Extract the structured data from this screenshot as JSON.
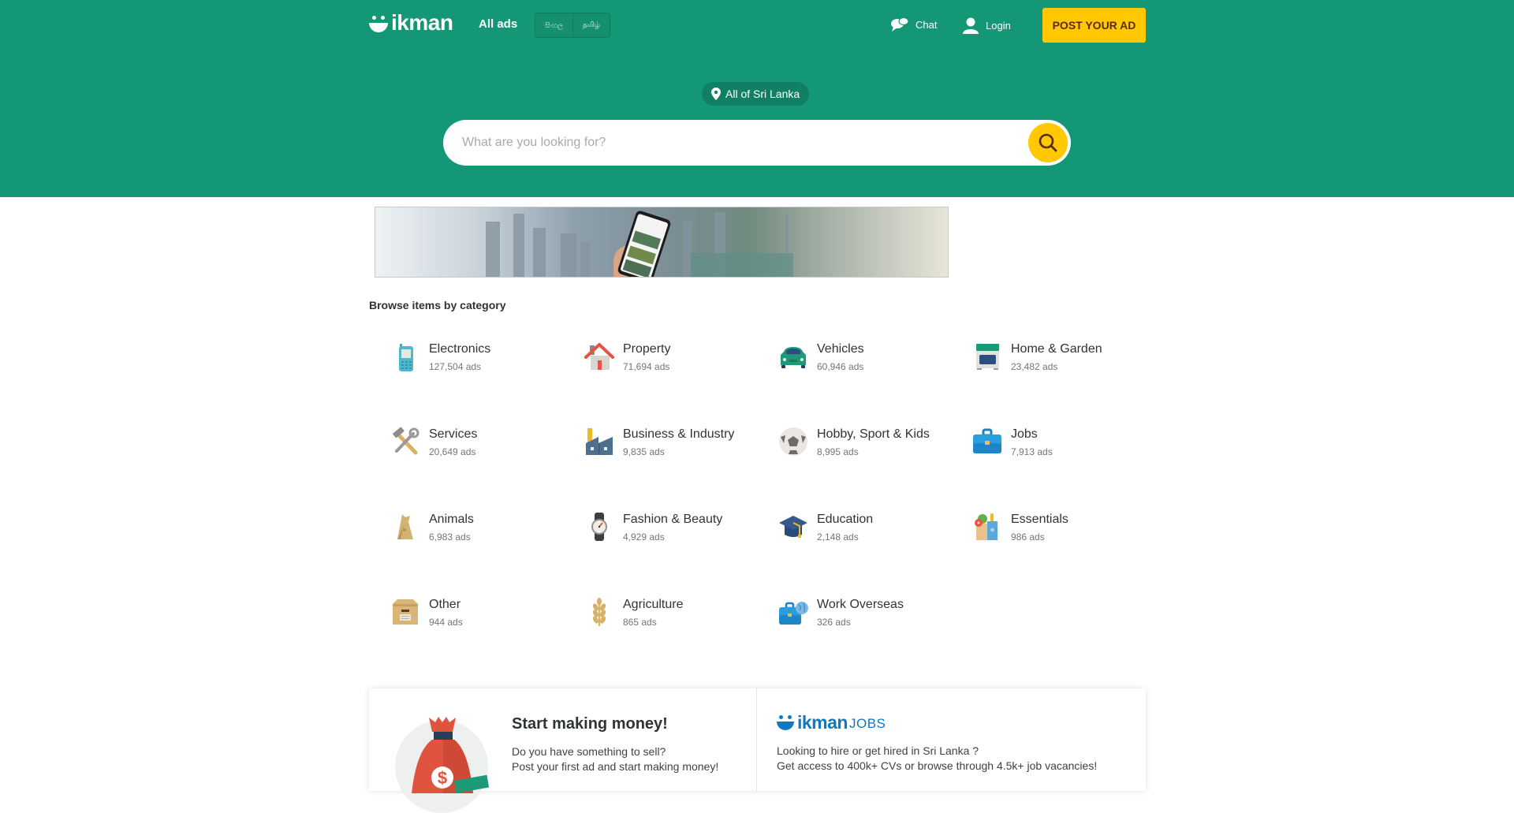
{
  "header": {
    "logo_text": "ikman",
    "all_ads": "All ads",
    "languages": [
      "සිංහල",
      "தமிழ்"
    ],
    "chat": "Chat",
    "login": "Login",
    "post_ad": "POST YOUR AD",
    "location": "All of Sri Lanka",
    "search_placeholder": "What are you looking for?",
    "search_value": ""
  },
  "colors": {
    "brand_green": "#149777",
    "accent_yellow": "#ffc800",
    "post_ad_text": "#5c2c06",
    "jobs_blue": "#1078bf"
  },
  "browse": {
    "title": "Browse items by category",
    "categories": [
      {
        "name": "Electronics",
        "count": "127,504 ads",
        "icon": "mobile-phone-icon"
      },
      {
        "name": "Property",
        "count": "71,694 ads",
        "icon": "house-icon"
      },
      {
        "name": "Vehicles",
        "count": "60,946 ads",
        "icon": "car-icon"
      },
      {
        "name": "Home & Garden",
        "count": "23,482 ads",
        "icon": "oven-icon"
      },
      {
        "name": "Services",
        "count": "20,649 ads",
        "icon": "hammer-wrench-icon"
      },
      {
        "name": "Business & Industry",
        "count": "9,835 ads",
        "icon": "factory-icon"
      },
      {
        "name": "Hobby, Sport & Kids",
        "count": "8,995 ads",
        "icon": "soccer-ball-icon"
      },
      {
        "name": "Jobs",
        "count": "7,913 ads",
        "icon": "briefcase-icon"
      },
      {
        "name": "Animals",
        "count": "6,983 ads",
        "icon": "dog-icon"
      },
      {
        "name": "Fashion & Beauty",
        "count": "4,929 ads",
        "icon": "wristwatch-icon"
      },
      {
        "name": "Education",
        "count": "2,148 ads",
        "icon": "graduation-cap-icon"
      },
      {
        "name": "Essentials",
        "count": "986 ads",
        "icon": "grocery-bag-icon"
      },
      {
        "name": "Other",
        "count": "944 ads",
        "icon": "cardboard-box-icon"
      },
      {
        "name": "Agriculture",
        "count": "865 ads",
        "icon": "wheat-icon"
      },
      {
        "name": "Work Overseas",
        "count": "326 ads",
        "icon": "briefcase-globe-icon"
      }
    ]
  },
  "promo": {
    "sell": {
      "title": "Start making money!",
      "line1": "Do you have something to sell?",
      "line2": "Post your first ad and start making money!"
    },
    "jobs": {
      "logo_word": "ikman",
      "logo_suffix": "JOBS",
      "line1": "Looking to hire or get hired in Sri Lanka ?",
      "line2": "Get access to 400k+ CVs or browse through 4.5k+ job vacancies!"
    }
  }
}
